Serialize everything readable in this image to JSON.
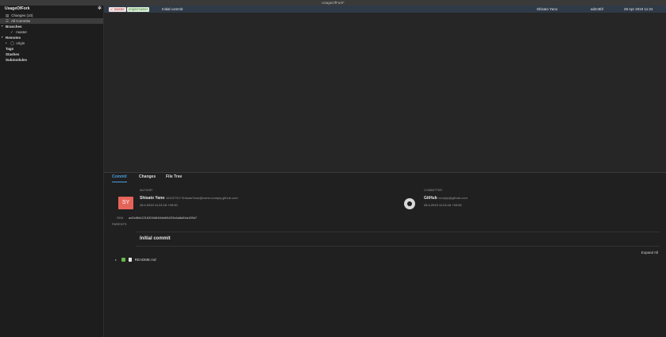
{
  "window": {
    "title": "UsageOfFork*"
  },
  "sidebar": {
    "repo_name": "UsageOfFork",
    "gear_icon": "gear-icon",
    "items": [
      {
        "label": "Changes (10)",
        "icon": "changes-icon"
      },
      {
        "label": "All Commits",
        "icon": "commits-icon",
        "selected": true
      }
    ],
    "branches_label": "Branches",
    "branches": [
      {
        "label": "master",
        "icon": "check-icon"
      }
    ],
    "remotes_label": "Remotes",
    "remotes": [
      {
        "label": "origin",
        "icon": "github-icon"
      }
    ],
    "tags_label": "Tags",
    "stashes_label": "Stashes",
    "submodules_label": "Submodules"
  },
  "commits": [
    {
      "tags": [
        {
          "label": "master",
          "kind": "local",
          "color": "#b94040"
        },
        {
          "label": "origin/master",
          "kind": "remote",
          "color": "#3f7f35"
        }
      ],
      "message": "Initial commit",
      "author": "Shisato Yano",
      "sha": "ad2c8bf",
      "date": "28 Apr 2019 11:24"
    }
  ],
  "details": {
    "tabs": [
      {
        "label": "Commit",
        "active": true
      },
      {
        "label": "Changes"
      },
      {
        "label": "File Tree"
      }
    ],
    "author_label": "AUTHOR",
    "author": {
      "initials": "SY",
      "name": "Shisato Yano",
      "email": "43152731+ShisatoYano@users.noreply.github.com",
      "date": "28.4.2019 11:24:16 +09:00",
      "avatar_color": "#e5645a"
    },
    "committer_label": "COMMITTER",
    "committer": {
      "name": "GitHub",
      "email": "noreply@github.com",
      "date": "28.4.2019 11:24:16 +09:00"
    },
    "sha_label": "SHA",
    "sha_value": "ad2c8bfc2216300d5484e6fb203c6a8a54a105b7",
    "parents_label": "PARENTS",
    "message": "Initial commit",
    "expand_all": "Expand All",
    "files": [
      {
        "name": "README.md",
        "status_color": "#66b84a"
      }
    ]
  }
}
